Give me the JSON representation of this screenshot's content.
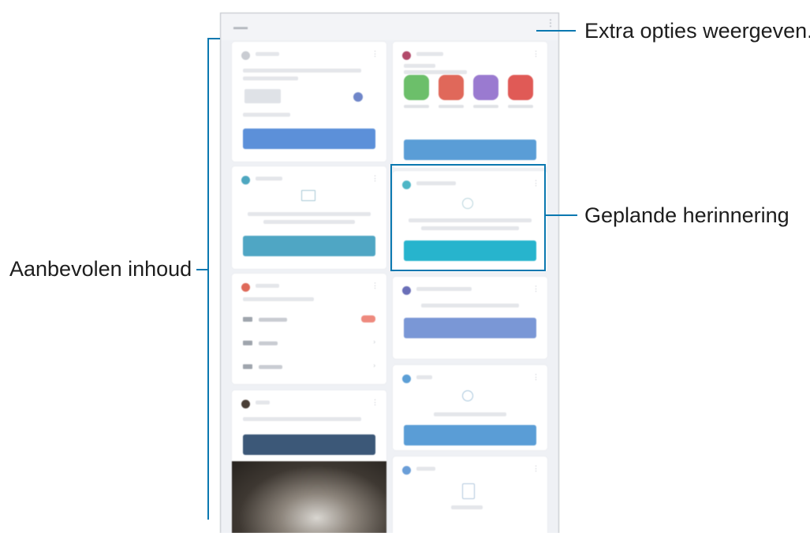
{
  "callouts": {
    "more_options": "Extra opties weergeven.",
    "scheduled_reminder": "Geplande herinnering",
    "recommended_content": "Aanbevolen inhoud"
  },
  "colors": {
    "callout_line": "#0a78b0",
    "card_bg": "#ffffff",
    "panel_bg": "#eff1f5"
  },
  "device": {
    "icons": [
      "more-vert-icon"
    ]
  }
}
